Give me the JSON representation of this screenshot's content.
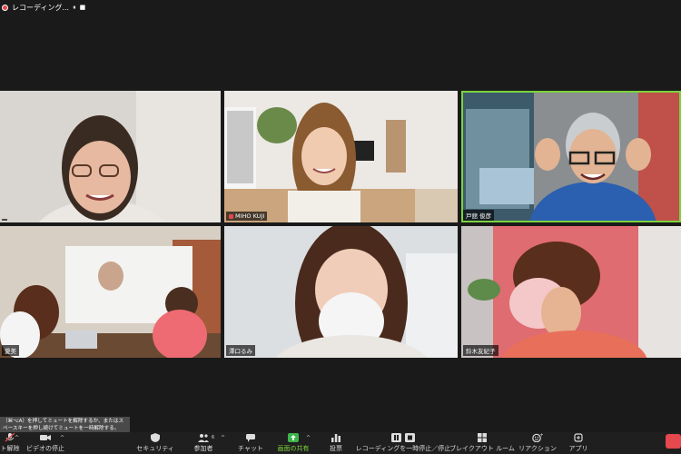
{
  "recording": {
    "title": "レコーディング...",
    "pause": "⏸",
    "stop": "■"
  },
  "participants": [
    {
      "name": ""
    },
    {
      "name": "MIHO KUJI"
    },
    {
      "name": "戸舘 俊彦"
    },
    {
      "name": "愛美"
    },
    {
      "name": "澤口るみ"
    },
    {
      "name": "鈴木友紀子"
    }
  ],
  "tooltip": "（⌘⌥A）を押してミュートを解除するか、またはスペースキーを押し続けてミュートを一時解除する。",
  "toolbar": {
    "unmute": "ト解除",
    "video": "ビデオの停止",
    "security": "セキュリティ",
    "participants": "参加者",
    "participants_count": "6",
    "chat": "チャット",
    "share": "画面の共有",
    "poll": "投票",
    "recording": "レコーディングを一時停止／停止",
    "breakout": "ブレイクアウト ルーム",
    "reactions": "リアクション",
    "apps": "アプリ"
  },
  "colors": {
    "active_speaker": "#7bd33d",
    "share_green": "#3bb54a",
    "end_red": "#e5484d"
  }
}
